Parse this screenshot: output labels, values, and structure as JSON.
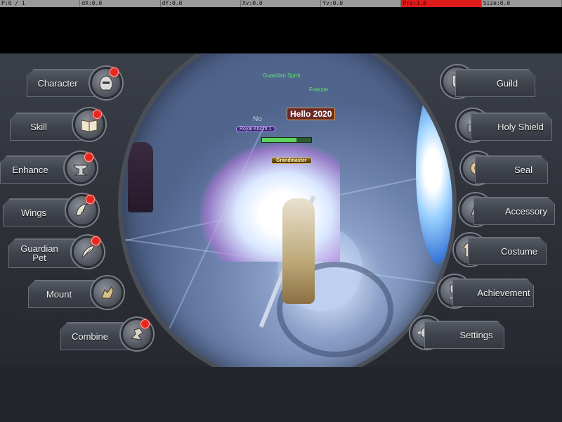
{
  "debug_bar": [
    {
      "text": "P:0 / 1"
    },
    {
      "text": "dX:0.0"
    },
    {
      "text": "dY:0.0"
    },
    {
      "text": "Xv:0.0"
    },
    {
      "text": "Yv:0.0"
    },
    {
      "text": "Prs:1.0",
      "highlight": true
    },
    {
      "text": "Size:0.0"
    }
  ],
  "scene": {
    "labels": {
      "guardian_spirit": "Guardian Spirit",
      "freezer": "Freezer",
      "name_partial": "No",
      "royal_knight": "Royal Knight 1",
      "grandmaster": "Grandmaster",
      "hello": "Hello 2020"
    }
  },
  "menu": {
    "left": [
      {
        "label": "Character",
        "icon": "helmet-icon",
        "badge": true
      },
      {
        "label": "Skill",
        "icon": "book-icon",
        "badge": true
      },
      {
        "label": "Enhance",
        "icon": "anvil-icon",
        "badge": true
      },
      {
        "label": "Wings",
        "icon": "wing-icon",
        "badge": true
      },
      {
        "label": "Guardian Pet",
        "icon": "feather-icon",
        "badge": true
      },
      {
        "label": "Mount",
        "icon": "mount-icon",
        "badge": false
      },
      {
        "label": "Combine",
        "icon": "combine-icon",
        "badge": true
      }
    ],
    "right": [
      {
        "label": "Guild",
        "icon": "guild-shield-icon",
        "badge": false
      },
      {
        "label": "Holy Shield",
        "icon": "lock-icon",
        "badge": false
      },
      {
        "label": "Seal",
        "icon": "seal-icon",
        "badge": false
      },
      {
        "label": "Accessory",
        "icon": "accessory-icon",
        "badge": false
      },
      {
        "label": "Costume",
        "icon": "costume-icon",
        "badge": false
      },
      {
        "label": "Achievement",
        "icon": "achievement-icon",
        "badge": false
      },
      {
        "label": "Settings",
        "icon": "gear-icon",
        "badge": false
      }
    ]
  },
  "colors": {
    "badge": "#e8281e",
    "prs_highlight": "#e01b1b"
  }
}
